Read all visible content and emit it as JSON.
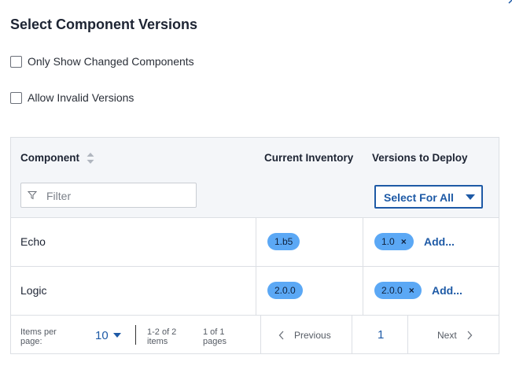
{
  "dialog": {
    "title": "Select Component Versions"
  },
  "options": [
    {
      "label": "Only Show Changed Components",
      "checked": false
    },
    {
      "label": "Allow Invalid Versions",
      "checked": false
    }
  ],
  "table": {
    "columns": [
      "Component",
      "Current Inventory",
      "Versions to Deploy"
    ],
    "filter_placeholder": "Filter",
    "select_all_label": "Select For All",
    "rows": [
      {
        "component": "Echo",
        "inventory": "1.b5",
        "deploy_version": "1.0",
        "remove": "×",
        "add": "Add..."
      },
      {
        "component": "Logic",
        "inventory": "2.0.0",
        "deploy_version": "2.0.0",
        "remove": "×",
        "add": "Add..."
      }
    ]
  },
  "pagination": {
    "items_per_page_label": "Items per page:",
    "items_per_page": "10",
    "range": "1-2 of 2 items",
    "pages": "1 of 1 pages",
    "previous": "Previous",
    "current_page": "1",
    "next": "Next"
  },
  "colors": {
    "accent": "#1e5aa6",
    "pill": "#5ba8f5",
    "header_bg": "#f4f6f9"
  }
}
